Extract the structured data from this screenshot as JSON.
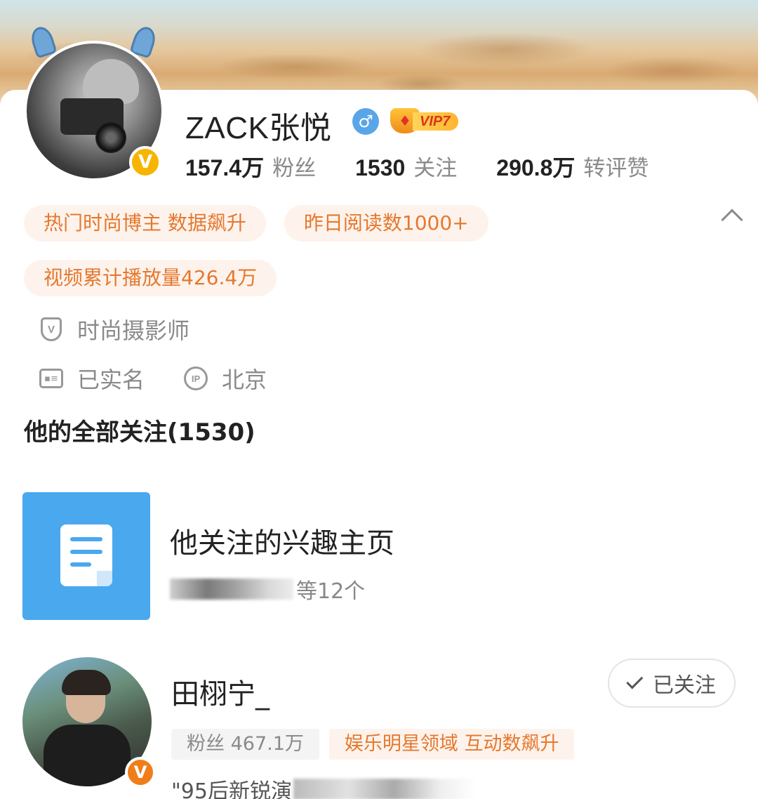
{
  "profile": {
    "name": "ZACK张悦",
    "gender_icon": "male-icon",
    "vip_label": "VIP7",
    "stats": [
      {
        "value": "157.4万",
        "label": "粉丝"
      },
      {
        "value": "1530",
        "label": "关注"
      },
      {
        "value": "290.8万",
        "label": "转评赞"
      }
    ],
    "tags_row1": [
      "热门时尚博主 数据飙升",
      "昨日阅读数1000+"
    ],
    "tags_row2": [
      "视频累计播放量426.4万"
    ],
    "occupation": "时尚摄影师",
    "verified_label": "已实名",
    "ip_location": "北京"
  },
  "following": {
    "title": "他的全部关注(1530)",
    "interest_pages": {
      "title": "他关注的兴趣主页",
      "subtitle_suffix": "等12个"
    },
    "users": [
      {
        "name": "田栩宁_",
        "fans": "粉丝 467.1万",
        "tag": "娱乐明星领域 互动数飙升",
        "desc_prefix": "\"95后新锐演",
        "button": "已关注"
      }
    ]
  },
  "colors": {
    "accent_orange": "#e6782e",
    "tag_bg": "#fdf3ec",
    "gender_blue": "#5aa5e8",
    "verified_yellow": "#f7b500",
    "interest_blue": "#4aa8ef"
  }
}
